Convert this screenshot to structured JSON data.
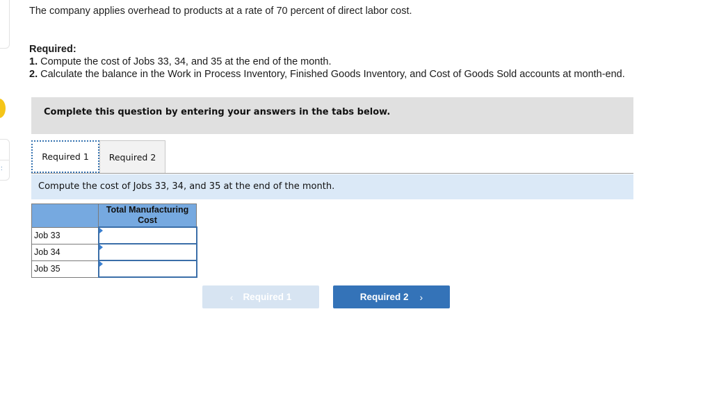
{
  "problem": {
    "intro": "The company applies overhead to products at a rate of 70 percent of direct labor cost.",
    "required_title": "Required:",
    "items": [
      {
        "num": "1.",
        "text": " Compute the cost of Jobs 33, 34, and 35 at the end of the month."
      },
      {
        "num": "2.",
        "text": " Calculate the balance in the Work in Process Inventory, Finished Goods Inventory, and Cost of Goods Sold accounts at month-end."
      }
    ]
  },
  "banner": "Complete this question by entering your answers in the tabs below.",
  "tabs": [
    {
      "label": "Required 1",
      "active": true
    },
    {
      "label": "Required 2",
      "active": false
    }
  ],
  "instruction": "Compute the cost of Jobs 33, 34, and 35 at the end of the month.",
  "table": {
    "header": [
      "",
      "Total Manufacturing Cost"
    ],
    "rows": [
      {
        "label": "Job 33",
        "value": ""
      },
      {
        "label": "Job 34",
        "value": ""
      },
      {
        "label": "Job 35",
        "value": ""
      }
    ]
  },
  "nav": {
    "prev_label": "Required 1",
    "prev_icon": "‹",
    "next_label": "Required 2",
    "next_icon": "›"
  },
  "colors": {
    "accent": "#3473b8",
    "table_header": "#76a9e0",
    "instruction_bg": "#dbe9f7",
    "banner_bg": "#e0e0e0"
  }
}
